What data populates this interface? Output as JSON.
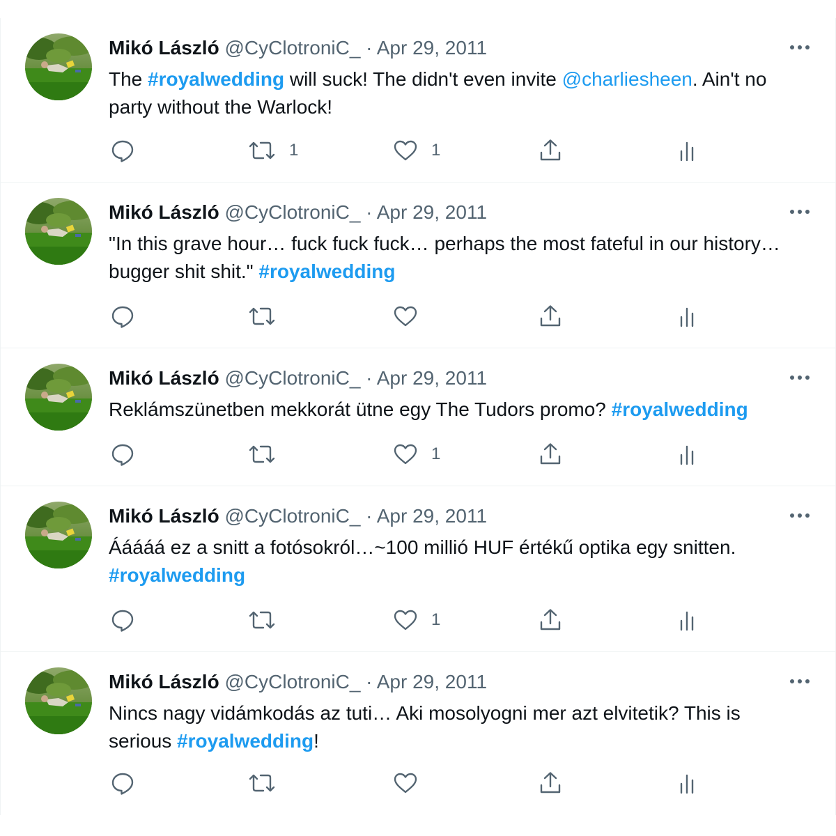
{
  "author": {
    "name": "Mikó László",
    "handle": "@CyClotroniC_"
  },
  "colors": {
    "accent": "#1d9bf0",
    "text": "#0f1419",
    "secondary": "#536471",
    "divider": "#eff3f4"
  },
  "tweets": [
    {
      "date": "Apr 29, 2011",
      "segments": [
        {
          "t": "text",
          "v": "The "
        },
        {
          "t": "hashtag",
          "v": "#royalwedding"
        },
        {
          "t": "text",
          "v": " will suck! The didn't even invite "
        },
        {
          "t": "mention",
          "v": "@charliesheen"
        },
        {
          "t": "text",
          "v": ". Ain't no party without the Warlock!"
        }
      ],
      "retweet_count": "1",
      "like_count": "1"
    },
    {
      "date": "Apr 29, 2011",
      "segments": [
        {
          "t": "text",
          "v": "\"In this grave hour… fuck fuck fuck… perhaps the most fateful in our history… bugger shit shit.\" "
        },
        {
          "t": "hashtag",
          "v": "#royalwedding"
        }
      ],
      "retweet_count": "",
      "like_count": ""
    },
    {
      "date": "Apr 29, 2011",
      "segments": [
        {
          "t": "text",
          "v": "Reklámszünetben mekkorát ütne egy The Tudors promo? "
        },
        {
          "t": "hashtag",
          "v": "#royalwedding"
        }
      ],
      "retweet_count": "",
      "like_count": "1"
    },
    {
      "date": "Apr 29, 2011",
      "segments": [
        {
          "t": "text",
          "v": "Ááááá ez a snitt a fotósokról…~100 millió HUF értékű optika egy snitten. "
        },
        {
          "t": "hashtag",
          "v": "#royalwedding"
        }
      ],
      "retweet_count": "",
      "like_count": "1"
    },
    {
      "date": "Apr 29, 2011",
      "segments": [
        {
          "t": "text",
          "v": "Nincs nagy vidámkodás az tuti… Aki mosolyogni mer azt elvitetik? This is serious "
        },
        {
          "t": "hashtag",
          "v": "#royalwedding"
        },
        {
          "t": "text",
          "v": "!"
        }
      ],
      "retweet_count": "",
      "like_count": ""
    }
  ]
}
